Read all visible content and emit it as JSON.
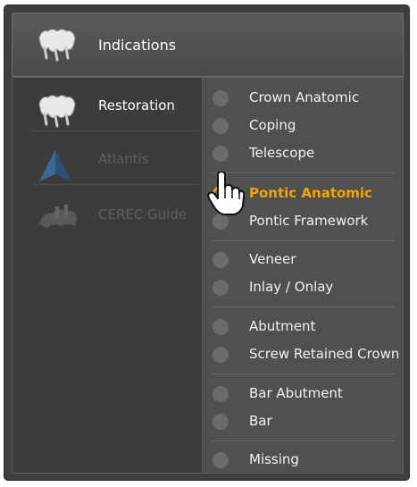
{
  "header": {
    "label": "Indications",
    "icon": "bridge-teeth-icon"
  },
  "left_menu": [
    {
      "label": "Restoration",
      "icon": "bridge-teeth-icon",
      "state": "active"
    },
    {
      "label": "Atlantis",
      "icon": "atlantis-logo-icon",
      "state": "disabled"
    },
    {
      "label": "CEREC Guide",
      "icon": "cerec-guide-icon",
      "state": "disabled"
    }
  ],
  "options": [
    {
      "label": "Crown Anatomic",
      "selected": false
    },
    {
      "label": "Coping",
      "selected": false
    },
    {
      "label": "Telescope",
      "selected": false
    },
    {
      "label": "Pontic Anatomic",
      "selected": true
    },
    {
      "label": "Pontic Framework",
      "selected": false
    },
    {
      "label": "Veneer",
      "selected": false
    },
    {
      "label": "Inlay / Onlay",
      "selected": false
    },
    {
      "label": "Abutment",
      "selected": false
    },
    {
      "label": "Screw Retained Crown",
      "selected": false
    },
    {
      "label": "Bar Abutment",
      "selected": false
    },
    {
      "label": "Bar",
      "selected": false
    },
    {
      "label": "Missing",
      "selected": false
    }
  ],
  "colors": {
    "accent": "#f5a300",
    "panel": "#3f3f3f",
    "disabled_text": "#5e5e5e"
  },
  "cursor_icon": "hand-pointer-icon"
}
